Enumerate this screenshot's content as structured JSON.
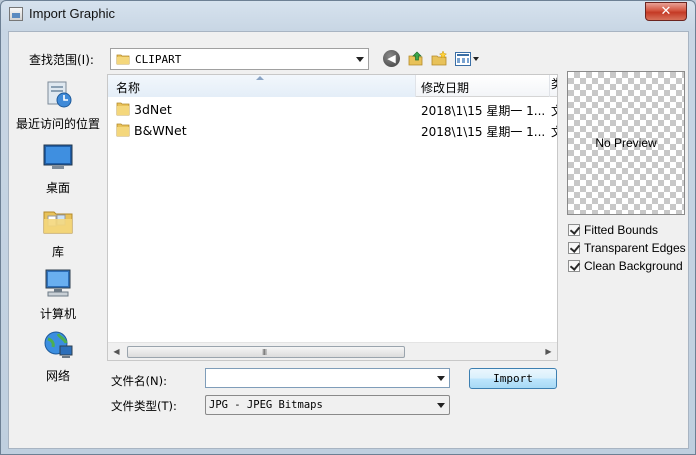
{
  "window": {
    "title": "Import Graphic",
    "close_label": "✕"
  },
  "look_in": {
    "label": "查找范围(I):",
    "value": "CLIPART"
  },
  "places": [
    {
      "id": "recent",
      "label": "最近访问的位置",
      "icon": "recent-places-icon"
    },
    {
      "id": "desktop",
      "label": "桌面",
      "icon": "desktop-icon"
    },
    {
      "id": "library",
      "label": "库",
      "icon": "library-icon"
    },
    {
      "id": "computer",
      "label": "计算机",
      "icon": "computer-icon"
    },
    {
      "id": "network",
      "label": "网络",
      "icon": "network-icon"
    }
  ],
  "file_list": {
    "columns": [
      "名称",
      "修改日期"
    ],
    "truncated_column": "类",
    "rows": [
      {
        "name": "3dNet",
        "date": "2018\\1\\15 星期一 1...",
        "trunc": "文"
      },
      {
        "name": "B&WNet",
        "date": "2018\\1\\15 星期一 1...",
        "trunc": "文"
      }
    ],
    "scroll_grip": "III"
  },
  "preview": {
    "text": "No Preview"
  },
  "options": [
    {
      "label": "Fitted Bounds",
      "checked": true
    },
    {
      "label": "Transparent Edges",
      "checked": true
    },
    {
      "label": "Clean Background",
      "checked": true
    }
  ],
  "filename": {
    "label": "文件名(N):",
    "value": "",
    "placeholder": ""
  },
  "filetype": {
    "label": "文件类型(T):",
    "value": "JPG - JPEG Bitmaps"
  },
  "buttons": {
    "import": "Import"
  },
  "colors": {
    "accent": "#3c7fb1",
    "close": "#c43a25",
    "folder": "#e8c25a"
  }
}
